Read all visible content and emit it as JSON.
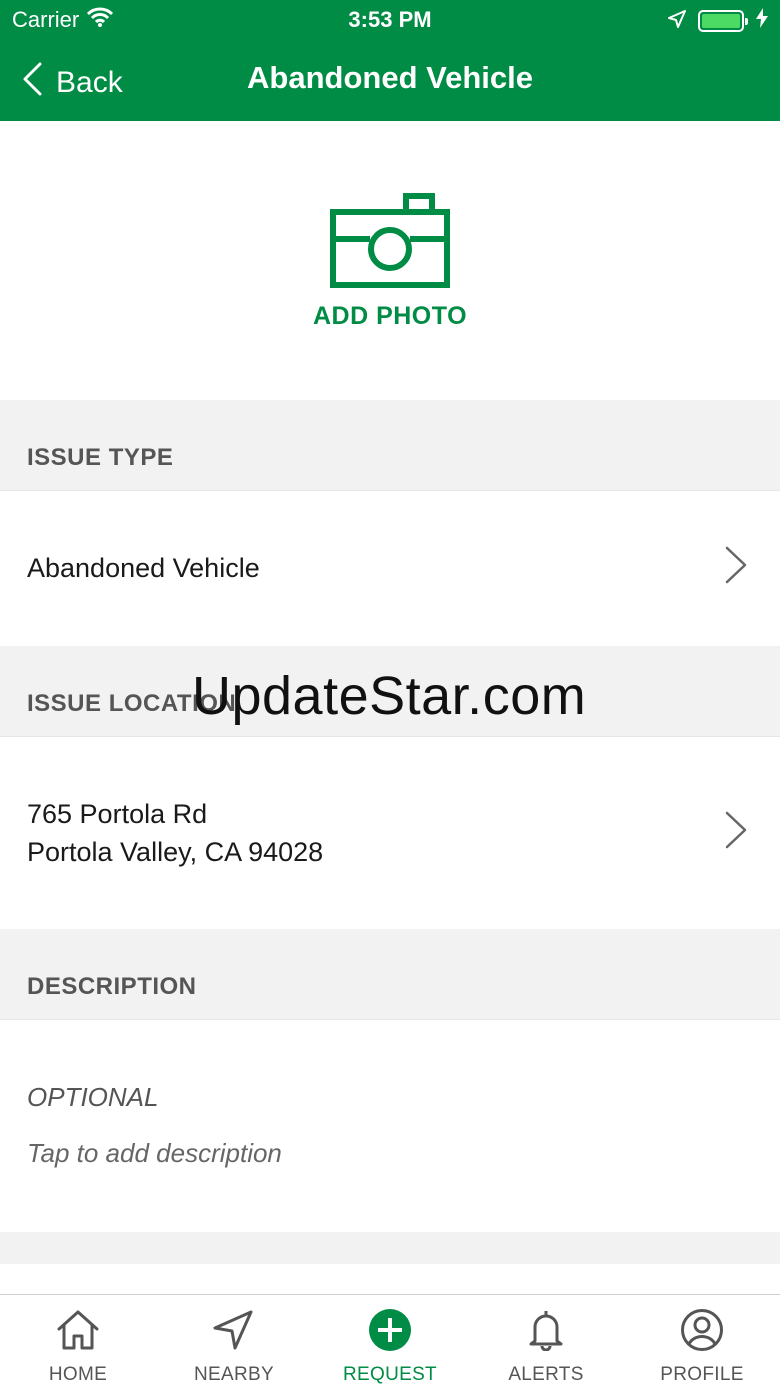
{
  "status_bar": {
    "carrier": "Carrier",
    "time": "3:53 PM"
  },
  "nav": {
    "back_label": "Back",
    "title": "Abandoned Vehicle"
  },
  "photo": {
    "label": "ADD PHOTO"
  },
  "issue_type": {
    "header": "ISSUE TYPE",
    "value": "Abandoned Vehicle"
  },
  "issue_location": {
    "header": "ISSUE LOCATION",
    "line1": "765 Portola Rd",
    "line2": "Portola Valley, CA 94028"
  },
  "description": {
    "header": "DESCRIPTION",
    "optional_label": "OPTIONAL",
    "placeholder": "Tap to add description"
  },
  "watermark": "UpdateStar.com",
  "tabs": [
    {
      "label": "HOME",
      "icon": "home-icon"
    },
    {
      "label": "NEARBY",
      "icon": "location-arrow-icon"
    },
    {
      "label": "REQUEST",
      "icon": "plus-circle-icon",
      "active": true
    },
    {
      "label": "ALERTS",
      "icon": "bell-icon"
    },
    {
      "label": "PROFILE",
      "icon": "user-icon"
    }
  ],
  "colors": {
    "brand_green": "#008c45",
    "section_bg": "#f2f2f2",
    "battery_green": "#4cd964"
  }
}
